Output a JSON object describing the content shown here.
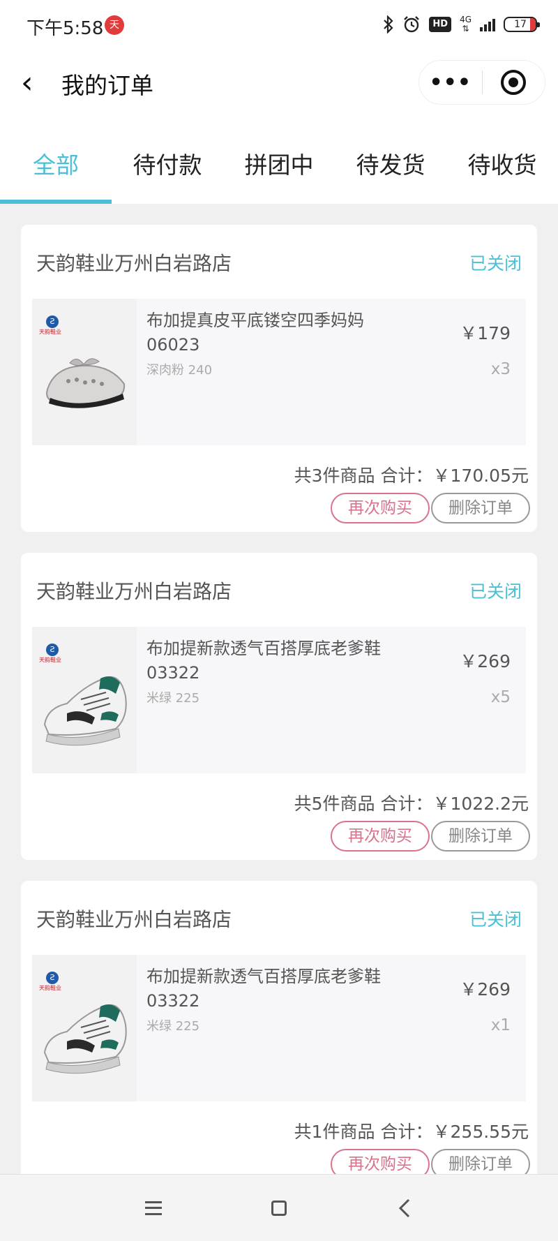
{
  "status_bar": {
    "time": "下午5:58",
    "app_icon_label": "天",
    "hd_label": "HD",
    "network_label": "4G",
    "battery_level": "17"
  },
  "nav": {
    "title": "我的订单",
    "back_glyph": "‹",
    "more_glyph": "•••"
  },
  "tabs": [
    {
      "label": "全部",
      "active": true
    },
    {
      "label": "待付款",
      "active": false
    },
    {
      "label": "拼团中",
      "active": false
    },
    {
      "label": "待发货",
      "active": false
    },
    {
      "label": "待收货",
      "active": false
    }
  ],
  "brand_logo_text": "天韵鞋业",
  "orders": [
    {
      "shop": "天韵鞋业万州白岩路店",
      "status": "已关闭",
      "product_name": "布加提真皮平底镂空四季妈妈06023",
      "spec": "深肉粉 240",
      "price": "￥179",
      "qty": "x3",
      "total": "共3件商品 合计：￥170.05元",
      "rebuy_label": "再次购买",
      "delete_label": "删除订单"
    },
    {
      "shop": "天韵鞋业万州白岩路店",
      "status": "已关闭",
      "product_name": "布加提新款透气百搭厚底老爹鞋03322",
      "spec": "米绿 225",
      "price": "￥269",
      "qty": "x5",
      "total": "共5件商品 合计：￥1022.2元",
      "rebuy_label": "再次购买",
      "delete_label": "删除订单"
    },
    {
      "shop": "天韵鞋业万州白岩路店",
      "status": "已关闭",
      "product_name": "布加提新款透气百搭厚底老爹鞋03322",
      "spec": "米绿 225",
      "price": "￥269",
      "qty": "x1",
      "total": "共1件商品 合计：￥255.55元",
      "rebuy_label": "再次购买",
      "delete_label": "删除订单"
    }
  ],
  "colors": {
    "accent": "#4bbfd6",
    "rebuy": "#d9728a",
    "background": "#f0f0f0"
  },
  "icons": [
    "bluetooth-icon",
    "alarm-icon",
    "signal-icon",
    "battery-icon",
    "back-icon",
    "more-icon",
    "close-icon",
    "menu-icon",
    "home-icon",
    "nav-back-icon"
  ]
}
